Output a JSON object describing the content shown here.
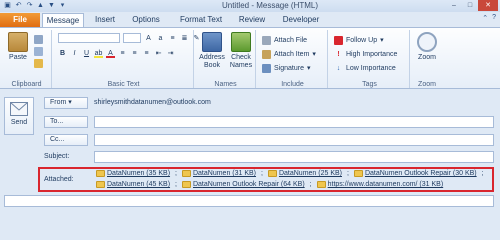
{
  "window": {
    "title": "Untitled - Message (HTML)",
    "qat_icons": [
      "save-icon",
      "undo-icon",
      "redo-icon",
      "up-arrow-icon",
      "down-arrow-icon",
      "customize-icon"
    ],
    "controls": [
      "minimize-icon",
      "maximize-icon",
      "close-icon"
    ]
  },
  "tabs": [
    {
      "label": "File",
      "active": false
    },
    {
      "label": "Message",
      "active": true
    },
    {
      "label": "Insert",
      "active": false
    },
    {
      "label": "Options",
      "active": false
    },
    {
      "label": "Format Text",
      "active": false
    },
    {
      "label": "Review",
      "active": false
    },
    {
      "label": "Developer",
      "active": false
    }
  ],
  "ribbon": {
    "clipboard": {
      "label": "Clipboard",
      "paste": "Paste"
    },
    "basic_text": {
      "label": "Basic Text",
      "bold": "B",
      "italic": "I",
      "underline": "U"
    },
    "names": {
      "label": "Names",
      "address_book": "Address Book",
      "check_names": "Check Names"
    },
    "include": {
      "label": "Include",
      "attach_file": "Attach File",
      "attach_item": "Attach Item",
      "signature": "Signature"
    },
    "tags": {
      "label": "Tags",
      "follow_up": "Follow Up",
      "high_importance": "High Importance",
      "low_importance": "Low Importance"
    },
    "zoom": {
      "label": "Zoom",
      "zoom_button": "Zoom"
    }
  },
  "compose": {
    "send": "Send",
    "from_button": "From",
    "from_value": "shirleysmithdatanumen@outlook.com",
    "to_button": "To...",
    "cc_button": "Cc...",
    "subject_label": "Subject:",
    "attached_label": "Attached:",
    "attachments_line1": [
      "DataNumen (35 KB)",
      "DataNumen (31 KB)",
      "DataNumen (25 KB)",
      "DataNumen Outlook Repair (30 KB)"
    ],
    "attachments_line2": [
      "DataNumen (45 KB)",
      "DataNumen Outlook Repair (64 KB)",
      "https://www.datanumen.com/ (31 KB)"
    ]
  },
  "colors": {
    "accent": "#e06d12",
    "ribbon_bg": "#dfe9f5",
    "highlight_border": "#d9262e"
  }
}
